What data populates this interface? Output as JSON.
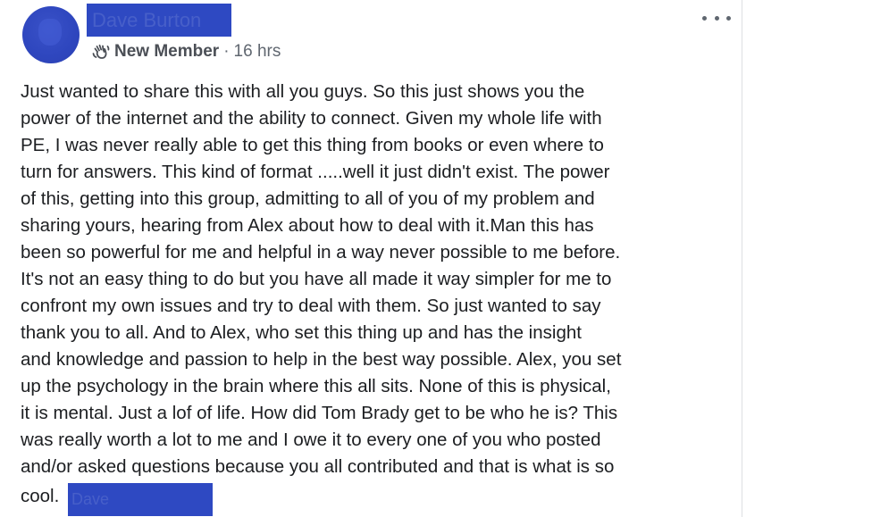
{
  "post": {
    "author_name": "Dave Burton",
    "badge_label": "New Member",
    "separator": "·",
    "timestamp": "16 hrs",
    "body_lines": [
      "Just wanted to share this with all you guys. So this just shows you the",
      "power of the internet and the ability to connect. Given my whole life with",
      "PE, I was never really able to get this thing from books or even where to",
      "turn for answers. This kind of format .....well it just didn't exist. The power",
      "of this, getting into this group, admitting to all of you of my problem and",
      "sharing yours, hearing from Alex about how to deal with it.Man this has",
      "been so powerful for me and helpful in a way never possible to me before.",
      "It's not an easy thing to do but you have all made it way simpler for me to",
      "confront my own issues and try to deal with them. So just wanted to say",
      "thank you to all. And to Alex, who set this thing up and has the insight",
      "and knowledge and passion to help in the best way possible. Alex, you set",
      "up the psychology in the brain where this all sits. None of this is physical,",
      "it is mental. Just a lof of life. How did Tom Brady get to be who he is? This",
      "was really worth a lot to me and I owe it to every one of you who posted",
      "and/or asked questions because you all contributed and that is what is so"
    ],
    "last_line_text": "cool.",
    "signature": "Dave"
  },
  "icons": {
    "badge": "waving-hand-icon",
    "more": "more-options-icon"
  },
  "colors": {
    "redaction": "#2e49c2",
    "text_primary": "#1c1e21",
    "text_secondary": "#606770"
  }
}
